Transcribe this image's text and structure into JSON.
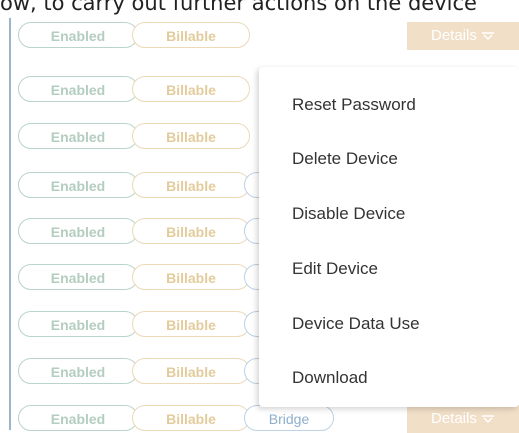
{
  "caption": "ow, to carry out further actions on the device",
  "rows": [
    {
      "enabled": "Enabled",
      "billable": "Billable",
      "third": "",
      "details": "Details"
    },
    {
      "enabled": "Enabled",
      "billable": "Billable",
      "third": "",
      "details": ""
    },
    {
      "enabled": "Enabled",
      "billable": "Billable",
      "third": "",
      "details": ""
    },
    {
      "enabled": "Enabled",
      "billable": "Billable",
      "third": "",
      "details": ""
    },
    {
      "enabled": "Enabled",
      "billable": "Billable",
      "third": "",
      "details": ""
    },
    {
      "enabled": "Enabled",
      "billable": "Billable",
      "third": "",
      "details": ""
    },
    {
      "enabled": "Enabled",
      "billable": "Billable",
      "third": "",
      "details": ""
    },
    {
      "enabled": "Enabled",
      "billable": "Billable",
      "third": "",
      "details": ""
    },
    {
      "enabled": "Enabled",
      "billable": "Billable",
      "third": "Bridge",
      "details": "Details"
    }
  ],
  "dropdown": {
    "items": [
      "Reset Password",
      "Delete Device",
      "Disable Device",
      "Edit Device",
      "Device Data Use",
      "Download"
    ]
  },
  "icons": {
    "details_chevron": "chevron-down-icon"
  },
  "colors": {
    "details_bg": "#f1dfc7",
    "enabled": "#b3cdbf",
    "billable": "#e3cc9b",
    "bridge": "#8eaecb"
  }
}
